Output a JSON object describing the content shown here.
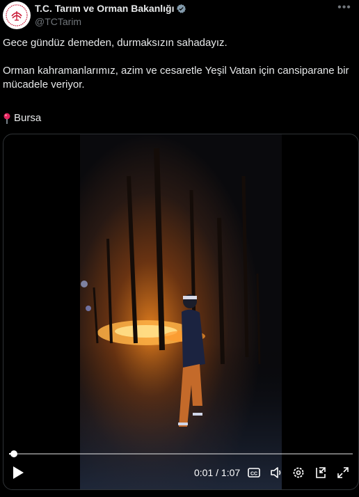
{
  "header": {
    "display_name": "T.C. Tarım ve Orman Bakanlığı",
    "handle": "@TCTarim",
    "more_label": "•••"
  },
  "tweet": {
    "paragraph1": "Gece gündüz demeden, durmaksızın sahadayız.",
    "paragraph2": "Orman kahramanlarımız, azim ve cesaretle Yeşil Vatan için cansiparane bir mücadele veriyor.",
    "location": "Bursa"
  },
  "video": {
    "time_display": "0:01 / 1:07",
    "progress_fraction": 0.015
  },
  "colors": {
    "background": "#000000",
    "text": "#e7e9ea",
    "muted": "#71767b",
    "verified_badge": "#829aab",
    "border": "#2f3336",
    "fire": "#f08a1c"
  },
  "icons": [
    "seal-logo-icon",
    "verified-badge-icon",
    "more-options-icon",
    "pin-icon",
    "play-icon",
    "captions-icon",
    "volume-icon",
    "settings-icon",
    "picture-in-picture-icon",
    "fullscreen-icon"
  ]
}
